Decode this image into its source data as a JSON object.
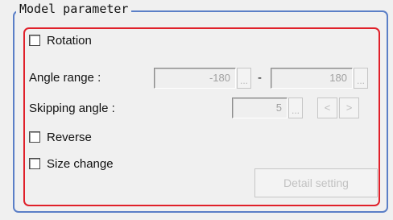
{
  "group": {
    "title": "Model parameter"
  },
  "rotation": {
    "label": "Rotation",
    "checked": false
  },
  "angle_range": {
    "label": "Angle range :",
    "min_value": "-180",
    "separator": "-",
    "max_value": "180",
    "ellipsis": "..."
  },
  "skipping_angle": {
    "label": "Skipping angle :",
    "value": "5",
    "ellipsis": "...",
    "decrease": "<",
    "increase": ">"
  },
  "reverse": {
    "label": "Reverse",
    "checked": false
  },
  "size_change": {
    "label": "Size change",
    "checked": false
  },
  "detail_button": {
    "label": "Detail setting"
  },
  "colors": {
    "group_border": "#5b7fc7",
    "highlight_border": "#e0202a",
    "disabled_text": "#c2c2c2"
  }
}
